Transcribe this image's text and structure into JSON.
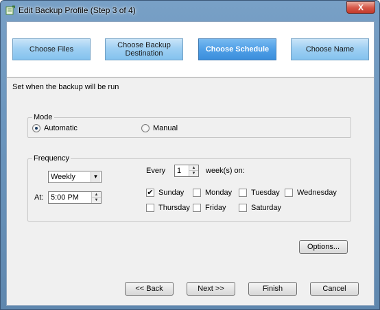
{
  "window": {
    "title": "Edit Backup Profile (Step 3 of 4)",
    "close_label": "X"
  },
  "steps": [
    {
      "label": "Choose Files"
    },
    {
      "label": "Choose Backup Destination"
    },
    {
      "label": "Choose Schedule"
    },
    {
      "label": "Choose Name"
    }
  ],
  "subtitle": "Set when the backup will be run",
  "mode": {
    "legend": "Mode",
    "automatic_label": "Automatic",
    "manual_label": "Manual",
    "selected": "Automatic"
  },
  "frequency": {
    "legend": "Frequency",
    "interval_value": "Weekly",
    "at_label": "At:",
    "time_value": "5:00 PM",
    "every_label": "Every",
    "every_value": "1",
    "weeks_on_label": "week(s) on:",
    "days": [
      {
        "label": "Sunday",
        "checked": true
      },
      {
        "label": "Monday",
        "checked": false
      },
      {
        "label": "Tuesday",
        "checked": false
      },
      {
        "label": "Wednesday",
        "checked": false
      },
      {
        "label": "Thursday",
        "checked": false
      },
      {
        "label": "Friday",
        "checked": false
      },
      {
        "label": "Saturday",
        "checked": false
      }
    ]
  },
  "buttons": {
    "options": "Options...",
    "back": "<< Back",
    "next": "Next >>",
    "finish": "Finish",
    "cancel": "Cancel"
  }
}
